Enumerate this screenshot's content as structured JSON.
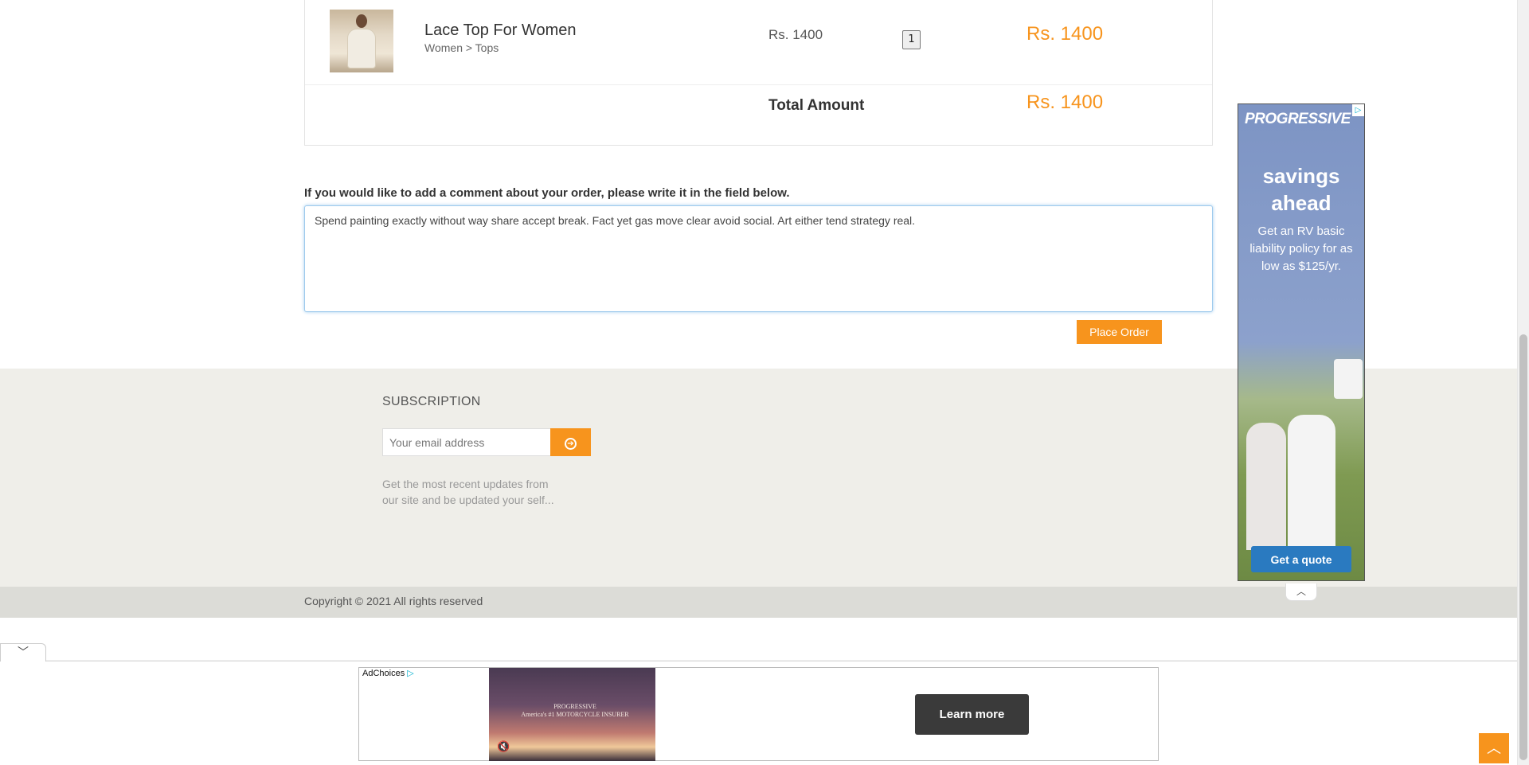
{
  "cart": {
    "item": {
      "name": "Lace Top For Women",
      "category": "Women > Tops",
      "price": "Rs. 1400",
      "quantity": "1",
      "line_total": "Rs. 1400"
    },
    "total_label": "Total Amount",
    "total_value": "Rs. 1400"
  },
  "comment": {
    "label": "If you would like to add a comment about your order, please write it in the field below.",
    "value": "Spend painting exactly without way share accept break. Fact yet gas move clear avoid social. Art either tend strategy real."
  },
  "actions": {
    "place_order": "Place Order"
  },
  "footer": {
    "subscription_title": "SUBSCRIPTION",
    "email_placeholder": "Your email address",
    "subscribe_icon": "arrow-circle-right-icon",
    "description": "Get the most recent updates from our site and be updated your self...",
    "copyright": "Copyright © 2021 All rights reserved"
  },
  "side_ad": {
    "brand": "PROGRESSIVE",
    "headline": "savings ahead",
    "body": "Get an RV basic liability policy for as low as $125/yr.",
    "cta": "Get a quote",
    "adchoices_icon": "adchoices-icon",
    "collapse_icon": "chevron-up-icon"
  },
  "bottom_ad": {
    "adchoices": "AdChoices",
    "video_text": "America's #1 MOTORCYCLE INSURER",
    "video_brand": "PROGRESSIVE",
    "cta": "Learn more",
    "mute_icon": "muted-speaker-icon",
    "toggle_icon": "chevron-down-icon"
  },
  "scroll_top_icon": "chevron-up-icon",
  "colors": {
    "accent": "#f7941d",
    "footer_bg": "#efeee9",
    "footer_bottom_bg": "#dcdcd7",
    "ad_cta": "#2a7ac0"
  }
}
